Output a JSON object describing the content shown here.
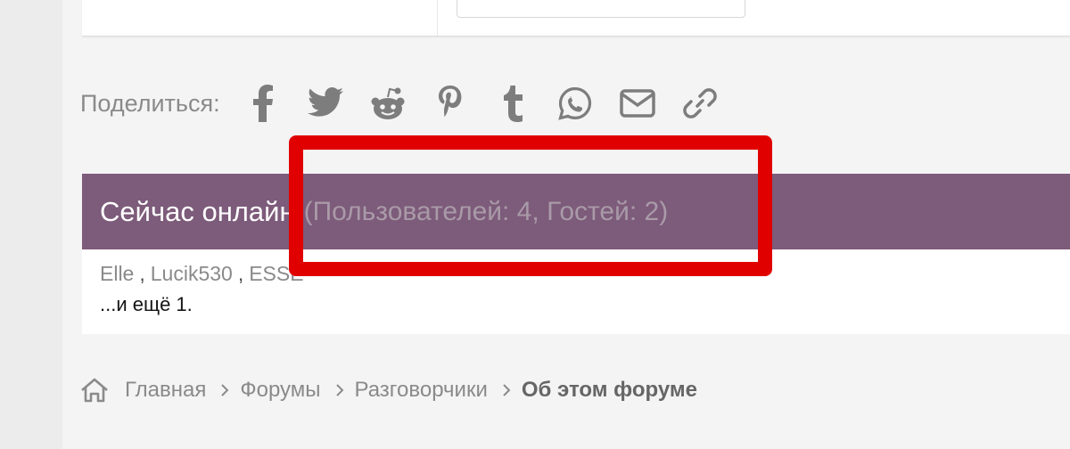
{
  "share": {
    "label": "Поделиться:",
    "icons": [
      "facebook-icon",
      "twitter-icon",
      "reddit-icon",
      "pinterest-icon",
      "tumblr-icon",
      "whatsapp-icon",
      "email-icon",
      "link-icon"
    ]
  },
  "online": {
    "title": "Сейчас онлайн",
    "counts": "(Пользователей: 4, Гостей: 2)",
    "users": [
      "Elle",
      "Lucik530",
      "ESSE"
    ],
    "separator": ",",
    "more": "...и ещё 1."
  },
  "breadcrumb": {
    "items": [
      "Главная",
      "Форумы",
      "Разговорчики",
      "Об этом форуме"
    ]
  },
  "colors": {
    "header_bg": "#7d5b7a",
    "highlight": "#e00000",
    "page_bg": "#f4f4f4",
    "icon_gray": "#7d7d7d"
  }
}
